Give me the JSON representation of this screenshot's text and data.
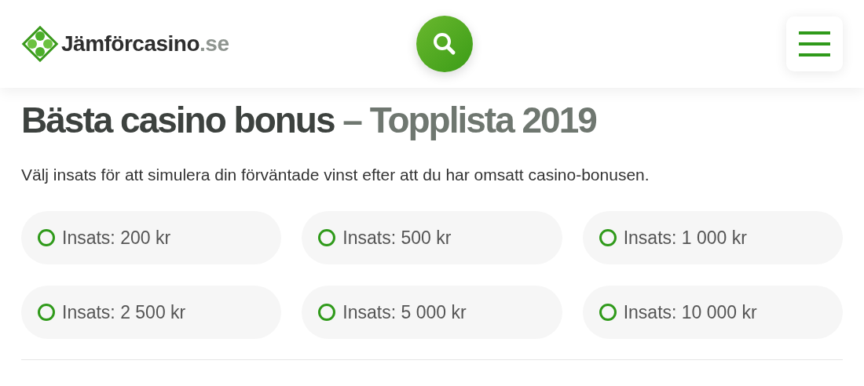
{
  "header": {
    "logo": {
      "name": "Jämförcasino",
      "suffix": ".se"
    }
  },
  "title": {
    "main": "Bästa casino bonus",
    "suffix": "– Topplista 2019"
  },
  "intro": "Välj insats för att simulera din förväntade vinst efter att du har omsatt casino-bonusen.",
  "stakes": [
    {
      "label": "Insats: 200 kr",
      "selected": false
    },
    {
      "label": "Insats: 500 kr",
      "selected": false
    },
    {
      "label": "Insats: 1 000 kr",
      "selected": false
    },
    {
      "label": "Insats: 2 500 kr",
      "selected": false
    },
    {
      "label": "Insats: 5 000 kr",
      "selected": false
    },
    {
      "label": "Insats: 10 000 kr",
      "selected": false
    }
  ]
}
